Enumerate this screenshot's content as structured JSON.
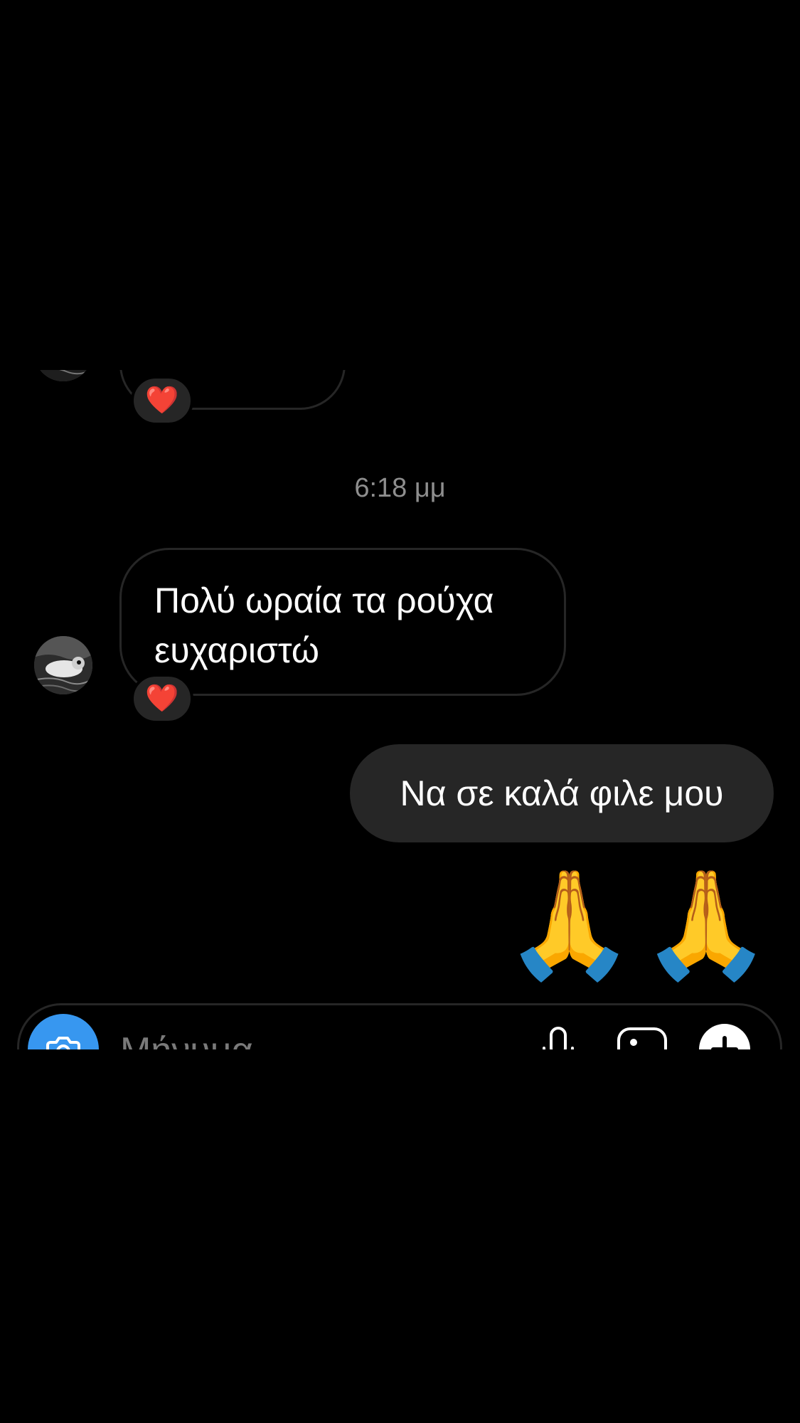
{
  "conversation": {
    "timestamp": "6:18 μμ",
    "incoming_message": {
      "lines": [
        "Πολύ ωραία τα ρούχα",
        "ευχαριστώ"
      ],
      "reaction": "❤️"
    },
    "previous_message": {
      "reaction": "❤️"
    },
    "outgoing_message": {
      "text": "Να σε καλά φιλε μου"
    },
    "emoji_message": [
      "🙏",
      "🙏"
    ]
  },
  "composer": {
    "placeholder": "Μήνυμα",
    "icons": [
      "camera-icon",
      "microphone-icon",
      "gallery-icon",
      "sticker-plus-icon"
    ]
  },
  "colors": {
    "background": "#000000",
    "bubble_sent": "#262626",
    "bubble_border": "#262626",
    "timestamp": "#8e8e8e",
    "camera_button": "#3797f0"
  }
}
